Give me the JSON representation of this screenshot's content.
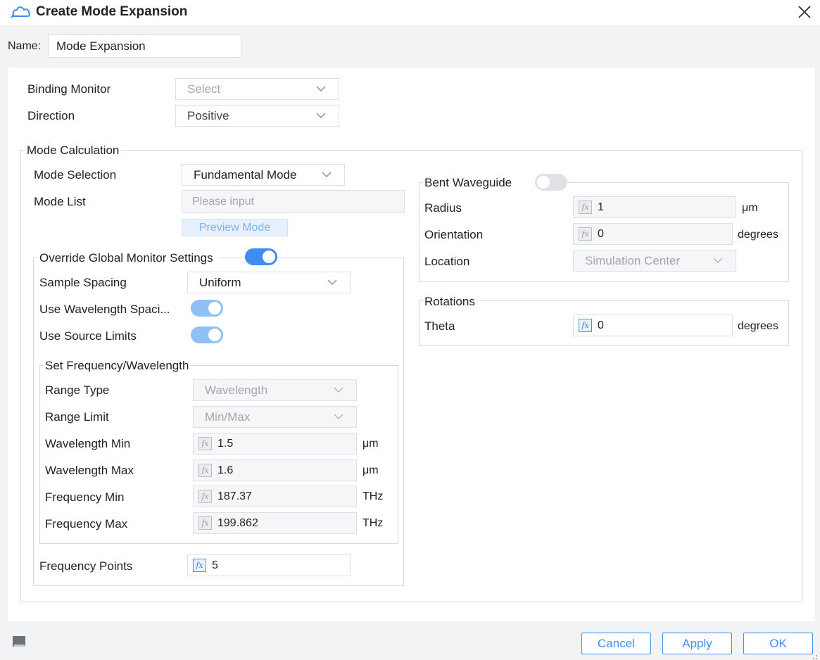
{
  "window": {
    "title": "Create Mode Expansion",
    "icon": "cloud-icon",
    "close_icon": "close-icon"
  },
  "name_field": {
    "label": "Name:",
    "value": "Mode Expansion"
  },
  "binding_monitor": {
    "label": "Binding Monitor",
    "value": "Select"
  },
  "direction": {
    "label": "Direction",
    "value": "Positive"
  },
  "mode_calculation": {
    "legend": "Mode Calculation",
    "mode_selection": {
      "label": "Mode Selection",
      "value": "Fundamental Mode"
    },
    "mode_list": {
      "label": "Mode List",
      "placeholder": "Please input"
    },
    "preview_button": "Preview Mode",
    "override": {
      "legend": "Override Global Monitor Settings",
      "enabled": true,
      "sample_spacing": {
        "label": "Sample Spacing",
        "value": "Uniform"
      },
      "use_wavelength_spacing": {
        "label": "Use Wavelength Spaci...",
        "enabled": true
      },
      "use_source_limits": {
        "label": "Use Source Limits",
        "enabled": true
      },
      "set_freq": {
        "legend": "Set Frequency/Wavelength",
        "range_type": {
          "label": "Range Type",
          "value": "Wavelength"
        },
        "range_limit": {
          "label": "Range Limit",
          "value": "Min/Max"
        },
        "wavelength_min": {
          "label": "Wavelength Min",
          "value": "1.5",
          "unit": "μm"
        },
        "wavelength_max": {
          "label": "Wavelength Max",
          "value": "1.6",
          "unit": "μm"
        },
        "frequency_min": {
          "label": "Frequency Min",
          "value": "187.37",
          "unit": "THz"
        },
        "frequency_max": {
          "label": "Frequency Max",
          "value": "199.862",
          "unit": "THz"
        }
      },
      "frequency_points": {
        "label": "Frequency Points",
        "value": "5"
      }
    }
  },
  "bent_waveguide": {
    "legend": "Bent Waveguide",
    "enabled": false,
    "radius": {
      "label": "Radius",
      "value": "1",
      "unit": "μm"
    },
    "orientation": {
      "label": "Orientation",
      "value": "0",
      "unit": "degrees"
    },
    "location": {
      "label": "Location",
      "value": "Simulation Center"
    }
  },
  "rotations": {
    "legend": "Rotations",
    "theta": {
      "label": "Theta",
      "value": "0",
      "unit": "degrees"
    }
  },
  "fx_glyph": "fx",
  "footer": {
    "cancel": "Cancel",
    "apply": "Apply",
    "ok": "OK"
  },
  "colors": {
    "accent": "#3d8ef0",
    "accent_light": "#8fc0f6",
    "border": "#dcdfe6",
    "background": "#f2f3f5"
  }
}
